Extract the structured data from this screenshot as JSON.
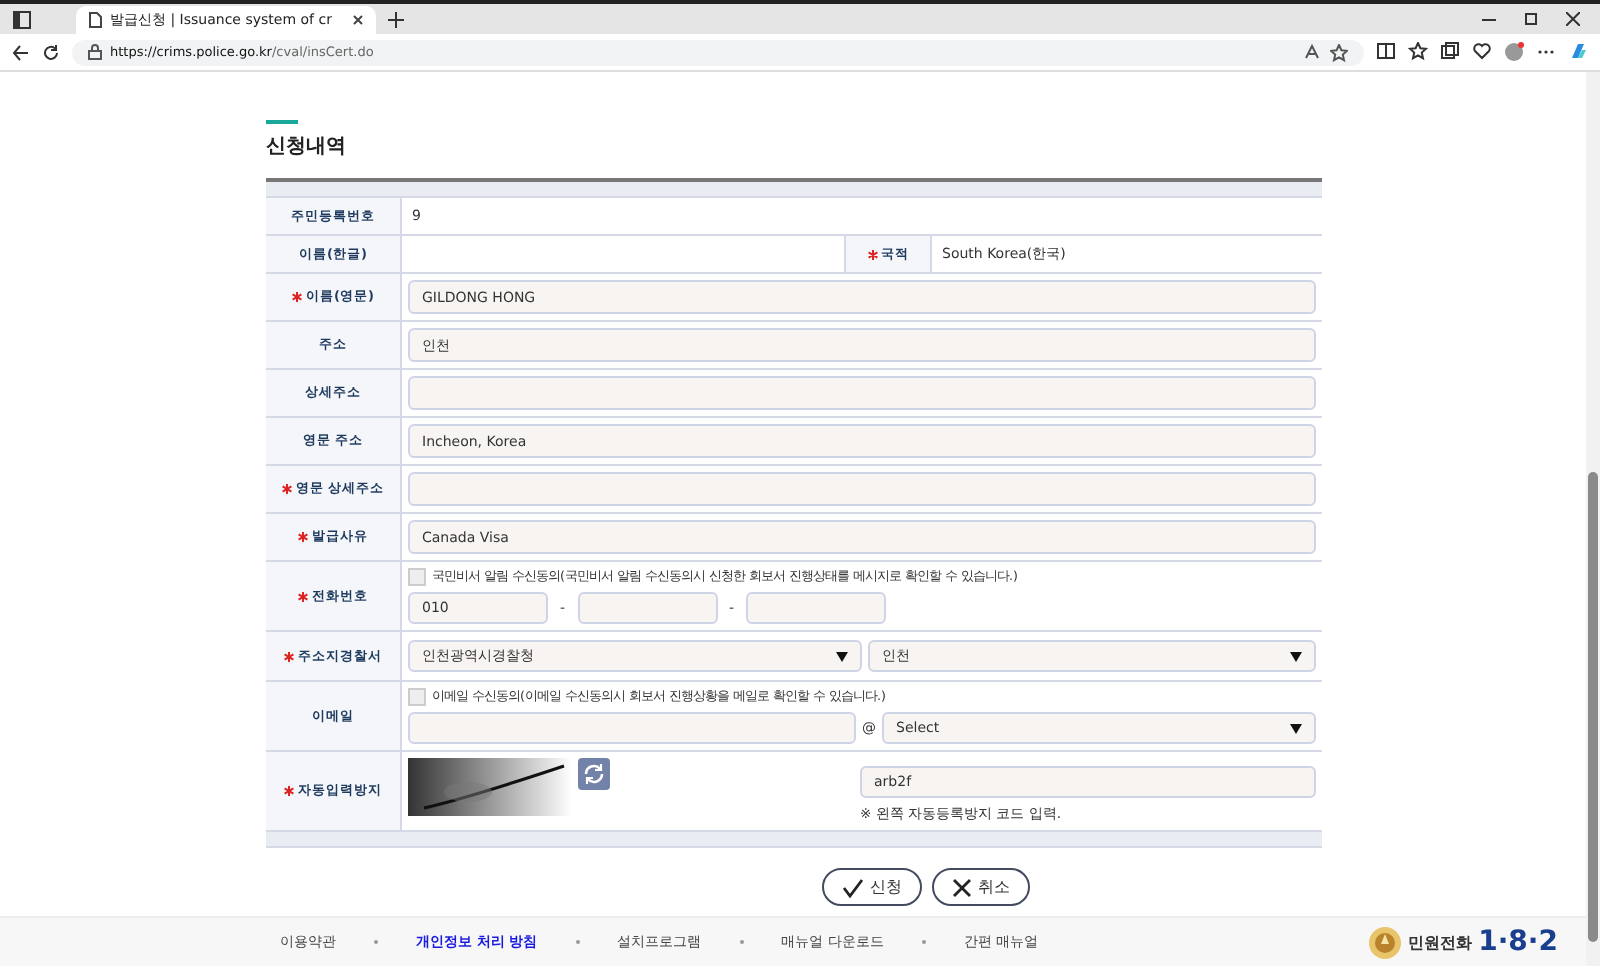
{
  "browser": {
    "tab_title": "발급신청 | Issuance system of cr",
    "url_host": "https://crims.police.go.kr",
    "url_path": "/cval/insCert.do"
  },
  "section_title": "신청내역",
  "rows": [
    {
      "kind": "text",
      "label": "주민등록번호",
      "required": false,
      "value": "9"
    },
    {
      "kind": "pair",
      "label": "이름(한글)",
      "required": false,
      "label2": "국적",
      "required2": true,
      "value2": "South Korea(한국)"
    },
    {
      "kind": "input",
      "label": "이름(영문)",
      "required": true,
      "value": "GILDONG HONG"
    },
    {
      "kind": "input",
      "label": "주소",
      "required": false,
      "value": "인천"
    },
    {
      "kind": "input",
      "label": "상세주소",
      "required": false
    },
    {
      "kind": "input",
      "label": "영문 주소",
      "required": false,
      "value": "Incheon, Korea"
    },
    {
      "kind": "input",
      "label": "영문 상세주소",
      "required": true
    },
    {
      "kind": "input",
      "label": "발급사유",
      "required": true,
      "value": "Canada Visa"
    },
    {
      "kind": "phone",
      "label": "전화번호",
      "required": true,
      "consent": "국민비서 알림 수신동의(국민비서 알림 수신동의시 신청한 회보서 진행상태를 메시지로 확인할 수 있습니다.)",
      "checked": false,
      "prefix": "010",
      "separator": "-"
    },
    {
      "kind": "selects",
      "label": "주소지경찰서",
      "required": true,
      "options": [
        "인천광역시경찰청",
        "인천"
      ]
    },
    {
      "kind": "email",
      "label": "이메일",
      "required": false,
      "consent": "이메일 수신동의(이메일 수신동의시 회보서 진행상황을 메일로 확인할 수 있습니다.)",
      "checked": false,
      "at": "@",
      "domain": "Select"
    },
    {
      "kind": "captcha",
      "label": "자동입력방지",
      "required": true,
      "value": "arb2f",
      "hint": "※ 왼쪽 자동등록방지 코드 입력."
    }
  ],
  "buttons": [
    {
      "kind": "submit",
      "label": "신청"
    },
    {
      "kind": "cancel",
      "label": "취소"
    }
  ],
  "footer": {
    "links": [
      {
        "label": "이용약관",
        "bold": false
      },
      {
        "label": "개인정보 처리 방침",
        "bold": true
      },
      {
        "label": "설치프로그램",
        "bold": false
      },
      {
        "label": "매뉴얼 다운로드",
        "bold": false
      },
      {
        "label": "간편 매뉴얼",
        "bold": false
      }
    ],
    "hotline": {
      "label": "민원전화",
      "number": "1·8·2"
    }
  }
}
